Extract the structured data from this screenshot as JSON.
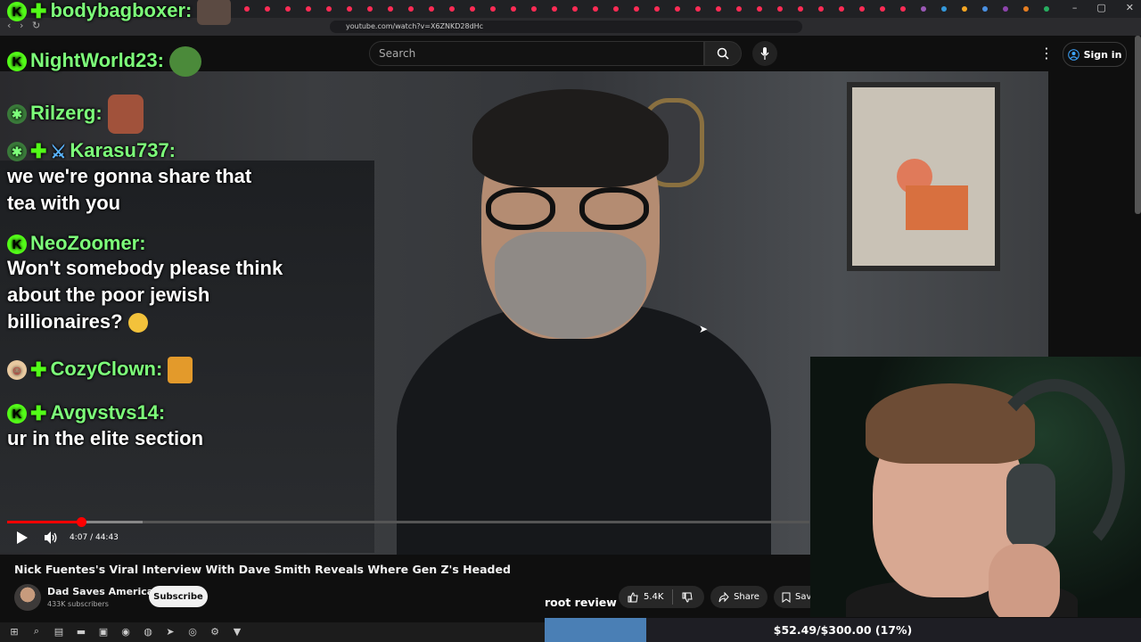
{
  "browser": {
    "url": "youtube.com/watch?v=X6ZNKD28dHc",
    "window_controls": [
      "–",
      "▢",
      "✕"
    ]
  },
  "youtube": {
    "search_placeholder": "Search",
    "sign_in_label": "Sign in",
    "video_time": "4:07 / 44:43",
    "progress_fraction": 0.092,
    "video_title": "Nick Fuentes's Viral Interview With Dave Smith Reveals Where Gen Z's Headed",
    "channel_name": "Dad Saves America",
    "subscribers": "433K subscribers",
    "subscribe_label": "Subscribe",
    "like_count": "5.4K",
    "share_label": "Share",
    "save_label": "Sav"
  },
  "chat": {
    "messages": [
      {
        "user": "bodybagboxer:",
        "text": ""
      },
      {
        "user": "NightWorld23:",
        "text": ""
      },
      {
        "user": "Rilzerg:",
        "text": ""
      },
      {
        "user": "Karasu737:",
        "text": "we we're gonna share that tea with you"
      },
      {
        "user": "NeoZoomer:",
        "text": "Won't somebody please think about the poor jewish billionaires?"
      },
      {
        "user": "CozyClown:",
        "text": ""
      },
      {
        "user": "Avgvstvs14:",
        "text": "ur in the elite section"
      }
    ]
  },
  "overlay": {
    "root_review": "root review",
    "goal_text": "$52.49/$300.00 (17%)",
    "goal_fraction": 0.17
  },
  "colors": {
    "username": "#7dff7a",
    "kick_badge": "#53fc18",
    "progress_red": "#ff0000",
    "goal_fill": "#4a7fb5"
  }
}
